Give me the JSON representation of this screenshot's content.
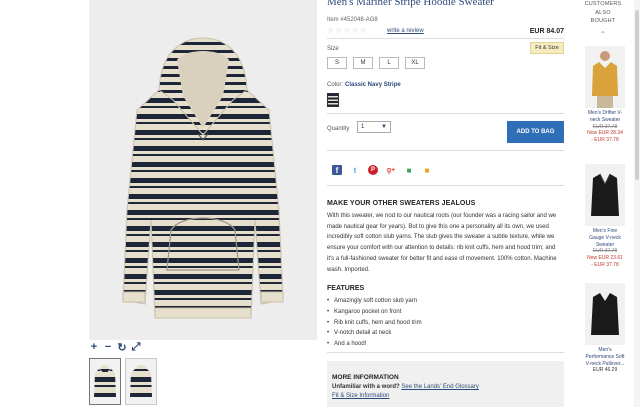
{
  "product": {
    "title": "Men's Mariner Stripe Hoodie Sweater",
    "item_no": "Item #452048-AG8",
    "stars": [
      "☆",
      "☆",
      "☆",
      "☆",
      "☆"
    ],
    "write_review": "write a review",
    "price": "EUR 84.07",
    "size_label": "Size",
    "fit_button": "Fit & Size",
    "sizes": [
      "S",
      "M",
      "L",
      "XL"
    ],
    "color_label": "Color:",
    "color_name": "Classic Navy Stripe",
    "quantity_label": "Quantity",
    "quantity_value": "1",
    "add_to_bag": "ADD TO BAG"
  },
  "zoom_tools": {
    "zoom_in": "+",
    "zoom_out": "−",
    "rotate": "↻",
    "expand": "⤢"
  },
  "social": {
    "facebook": "f",
    "twitter": "t",
    "pinterest": "P",
    "google_plus": "g+",
    "other1": "■",
    "other2": "■"
  },
  "description": {
    "heading": "MAKE YOUR OTHER SWEATERS JEALOUS",
    "body": "With this sweater, we nod to our nautical roots (our founder was a racing sailor and we made nautical gear for years). But to give this one a personality all its own, we used incredibly soft cotton slub yarns. The slub gives the sweater a subtle texture, while we ensure your comfort with our attention to details: rib knit cuffs, hem and hood trim; and it's a full-fashioned sweater for better fit and ease of movement. 100% cotton. Machine wash. Imported."
  },
  "features": {
    "heading": "FEATURES",
    "items": [
      "Amazingly soft cotton slub yarn",
      "Kangaroo pocket on front",
      "Rib knit cuffs, hem and hood trim",
      "V-notch detail at neck",
      "And a hood!"
    ]
  },
  "more_info": {
    "heading": "MORE INFORMATION",
    "unfamiliar_label": "Unfamiliar with a word?",
    "glossary_link": "See the Lands' End Glossary",
    "fit_link": "Fit & Size Information"
  },
  "rail": {
    "heading": [
      "CUSTOMERS",
      "ALSO",
      "BOUGHT"
    ],
    "items": [
      {
        "name": "Men's Drifter V-neck Sweater",
        "was": "EUR 37.78",
        "now": "Now EUR 28.34",
        "range": "- EUR 37.78",
        "color": "#d9a23a"
      },
      {
        "name": "Men's Fine Gauge V-neck Sweater",
        "was": "EUR 37.78",
        "now": "Now EUR 23.61",
        "range": "- EUR 37.78",
        "color": "#1b1b1b"
      },
      {
        "name": "Men's Performance Soft V-neck Pullover...",
        "price": "EUR 46.29",
        "color": "#1a1a1a"
      }
    ]
  },
  "colors": {
    "link": "#2b4a7a",
    "button_blue": "#2e6fb7",
    "fit_button_bg": "#f6ecc0",
    "sale_red": "#c0392b",
    "stripe_navy": "#1d2538",
    "stripe_cream": "#e8e0cc"
  }
}
